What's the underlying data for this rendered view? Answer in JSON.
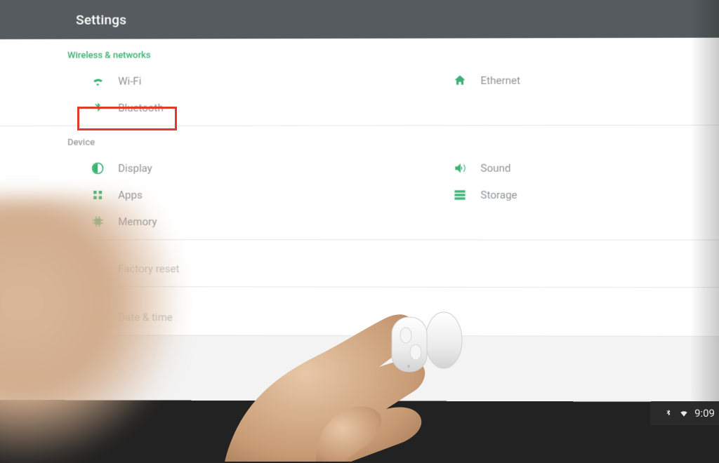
{
  "titlebar": {
    "title": "Settings"
  },
  "sections": {
    "wireless": {
      "header": "Wireless & networks",
      "wifi": "Wi-Fi",
      "bluetooth": "Bluetooth",
      "ethernet": "Ethernet"
    },
    "device": {
      "header": "Device",
      "display": "Display",
      "sound": "Sound",
      "apps": "Apps",
      "storage": "Storage",
      "memory": "Memory"
    },
    "personal": {
      "factory_reset": "Factory reset"
    },
    "system": {
      "date_time": "Date & time"
    }
  },
  "statusbar": {
    "time": "9:09"
  },
  "highlight": {
    "target": "bluetooth"
  }
}
